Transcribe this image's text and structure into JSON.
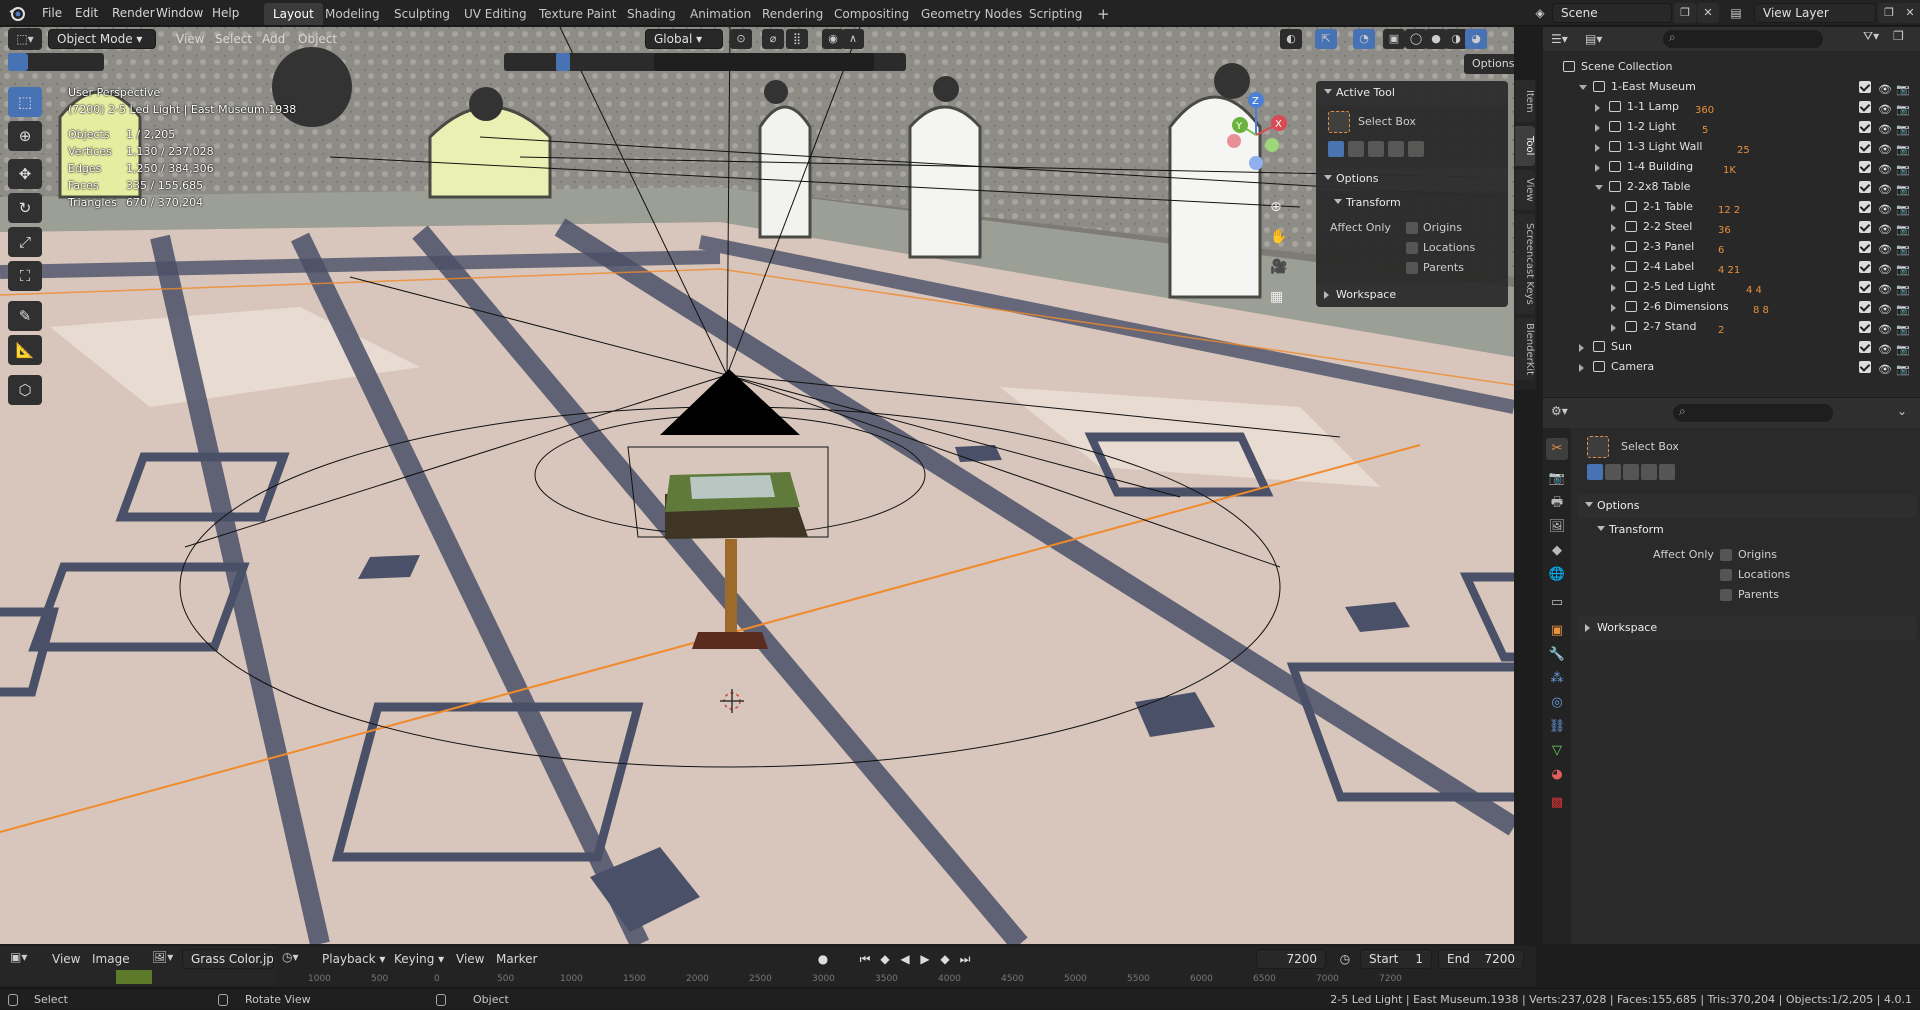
{
  "app": {
    "logo": "blender-logo-icon"
  },
  "menu": [
    "File",
    "Edit",
    "Render",
    "Window",
    "Help"
  ],
  "workspaces": [
    "Layout",
    "Modeling",
    "Sculpting",
    "UV Editing",
    "Texture Paint",
    "Shading",
    "Animation",
    "Rendering",
    "Compositing",
    "Geometry Nodes",
    "Scripting"
  ],
  "active_workspace": "Layout",
  "scene": {
    "name": "Scene",
    "view_layer": "View Layer"
  },
  "viewport": {
    "mode": "Object Mode",
    "header_menus": [
      "View",
      "Select",
      "Add",
      "Object"
    ],
    "orientation": "Global",
    "options_label": "Options",
    "perspective": "User Perspective",
    "context": "(7200) 2-5 Led Light | East Museum.1938",
    "stats": [
      {
        "label": "Objects",
        "value": "1 / 2,205"
      },
      {
        "label": "Vertices",
        "value": "1,130 / 237,028"
      },
      {
        "label": "Edges",
        "value": "1,250 / 384,306"
      },
      {
        "label": "Faces",
        "value": "335 / 155,685"
      },
      {
        "label": "Triangles",
        "value": "670 / 370,204"
      }
    ],
    "gizmo_axes": [
      "Z",
      "Y",
      "X"
    ]
  },
  "npanel": {
    "active_tool_title": "Active Tool",
    "tool_name": "Select Box",
    "options_title": "Options",
    "transform_title": "Transform",
    "affect_only": "Affect Only",
    "checks": [
      "Origins",
      "Locations",
      "Parents"
    ],
    "workspace_title": "Workspace",
    "tabs": [
      "Item",
      "Tool",
      "View",
      "Screencast Keys",
      "BlenderKit"
    ]
  },
  "outliner": {
    "root": "Scene Collection",
    "rows": [
      {
        "name": "1-East Museum",
        "level": 0,
        "open": true,
        "badge": ""
      },
      {
        "name": "1-1 Lamp",
        "level": 1,
        "open": false,
        "badge": "360"
      },
      {
        "name": "1-2 Light",
        "level": 1,
        "open": false,
        "badge": "5"
      },
      {
        "name": "1-3 Light Wall",
        "level": 1,
        "open": false,
        "badge": "25"
      },
      {
        "name": "1-4 Building",
        "level": 1,
        "open": false,
        "badge": "1K"
      },
      {
        "name": "2-2x8 Table",
        "level": 1,
        "open": true,
        "badge": ""
      },
      {
        "name": "2-1 Table",
        "level": 2,
        "open": false,
        "badge": "12 2"
      },
      {
        "name": "2-2 Steel",
        "level": 2,
        "open": false,
        "badge": "36"
      },
      {
        "name": "2-3 Panel",
        "level": 2,
        "open": false,
        "badge": "6"
      },
      {
        "name": "2-4 Label",
        "level": 2,
        "open": false,
        "badge": "4 21"
      },
      {
        "name": "2-5 Led Light",
        "level": 2,
        "open": false,
        "badge": "4 4"
      },
      {
        "name": "2-6 Dimensions",
        "level": 2,
        "open": false,
        "badge": "8 8"
      },
      {
        "name": "2-7 Stand",
        "level": 2,
        "open": false,
        "badge": "2"
      },
      {
        "name": "Sun",
        "level": 0,
        "open": false,
        "badge": ""
      },
      {
        "name": "Camera",
        "level": 0,
        "open": false,
        "badge": ""
      }
    ]
  },
  "properties": {
    "tool_name": "Select Box",
    "options_title": "Options",
    "transform_title": "Transform",
    "affect_only": "Affect Only",
    "checks": [
      "Origins",
      "Locations",
      "Parents"
    ],
    "workspace_title": "Workspace"
  },
  "image_editor": {
    "menus": [
      "View",
      "Image"
    ],
    "image_name": "Grass Color.jpg"
  },
  "timeline": {
    "menus": [
      "Playback",
      "Keying",
      "View",
      "Marker"
    ],
    "current_frame": "7200",
    "start_label": "Start",
    "start": "1",
    "end_label": "End",
    "end": "7200",
    "ruler": [
      "1000",
      "500",
      "0",
      "500",
      "1000",
      "1500",
      "2000",
      "2500",
      "3000",
      "3500",
      "4000",
      "4500",
      "5000",
      "5500",
      "6000",
      "6500",
      "7000",
      "7200"
    ]
  },
  "status": {
    "left": [
      "Select",
      "Rotate View",
      "Object"
    ],
    "right": "2-5 Led Light | East Museum.1938 | Verts:237,028 | Faces:155,685 | Tris:370,204 | Objects:1/2,205 | 4.0.1"
  }
}
